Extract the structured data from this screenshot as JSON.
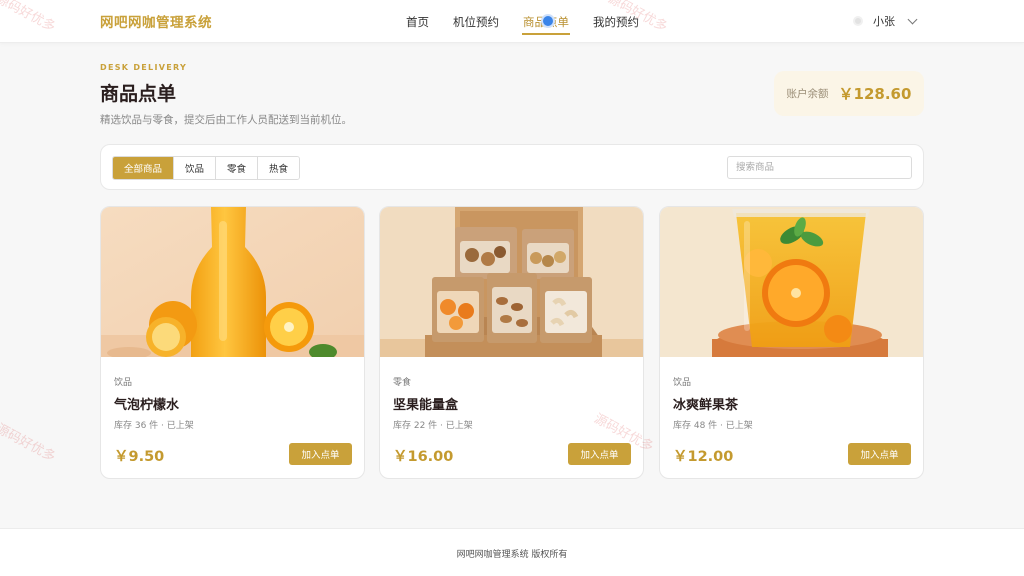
{
  "header": {
    "brand": "网吧网咖管理系统",
    "nav": [
      "首页",
      "机位预约",
      "商品点单",
      "我的预约"
    ],
    "active_nav": "商品点单",
    "user_name": "小张"
  },
  "hero": {
    "eyebrow": "DESK DELIVERY",
    "title": "商品点单",
    "subtitle": "精选饮品与零食，提交后由工作人员配送到当前机位。",
    "balance_label": "账户余额",
    "balance_value": "￥128.60"
  },
  "filter": {
    "tabs": [
      "全部商品",
      "饮品",
      "零食",
      "热食"
    ],
    "active_tab": "全部商品",
    "search_placeholder": "搜索商品"
  },
  "products": [
    {
      "category": "饮品",
      "name": "气泡柠檬水",
      "stock": "库存 36 件 · 已上架",
      "price": "￥9.50",
      "button": "加入点单"
    },
    {
      "category": "零食",
      "name": "坚果能量盒",
      "stock": "库存 22 件 · 已上架",
      "price": "￥16.00",
      "button": "加入点单"
    },
    {
      "category": "饮品",
      "name": "冰爽鲜果茶",
      "stock": "库存 48 件 · 已上架",
      "price": "￥12.00",
      "button": "加入点单"
    }
  ],
  "footer": {
    "copyright": "网吧网咖管理系统 版权所有"
  },
  "watermark": "源码好优多",
  "colors": {
    "accent": "#c9a13a",
    "price": "#c49a2f",
    "title": "#2a1e1e",
    "balance_bg": "#fbf5e7"
  }
}
